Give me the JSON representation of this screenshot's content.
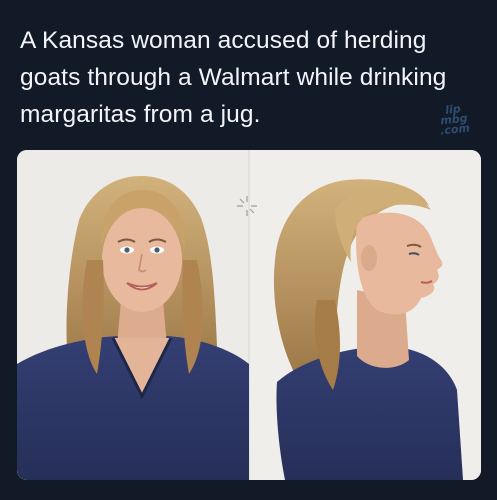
{
  "post": {
    "caption": "A Kansas woman accused of herding goats through a Walmart while drinking margaritas from a jug."
  },
  "watermark": {
    "line1": "lip",
    "line2": "mbg",
    "line3": ".com"
  },
  "image": {
    "panels": [
      "front-view",
      "profile-view"
    ],
    "colors": {
      "background": "#121a28",
      "backdrop": "#eceae6",
      "hair": "#b8915a",
      "skin": "#e6b69a",
      "shirt": "#2c3766"
    }
  }
}
